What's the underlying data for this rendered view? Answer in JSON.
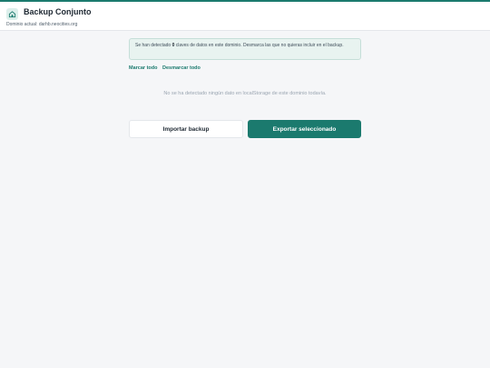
{
  "colors": {
    "accent": "#1b7a6e",
    "background": "#f5f6f8",
    "notice_bg": "#e8f3f0"
  },
  "header": {
    "logo_icon": "home-icon",
    "title": "Backup Conjunto",
    "domain_line": "Dominio actual: darhb.neocities.org"
  },
  "notice": {
    "prefix": "Se han detectado ",
    "count": "0",
    "suffix": " claves de datos en este dominio. Desmarca las que no quieras incluir en el backup."
  },
  "links": {
    "select_all": "Marcar todo",
    "deselect_all": "Desmarcar todo"
  },
  "empty_state": "No se ha detectado ningún dato en localStorage de este dominio todavía.",
  "buttons": {
    "import": "Importar backup",
    "export": "Exportar seleccionado"
  }
}
